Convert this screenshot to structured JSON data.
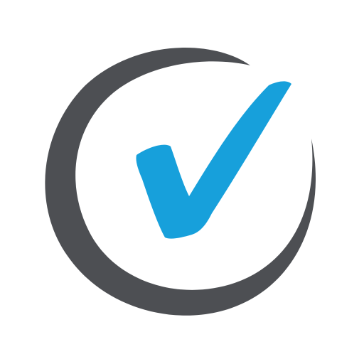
{
  "logo": {
    "icon": "checkmark-circle-icon",
    "colors": {
      "ring": "#4d4f53",
      "check": "#17a0db",
      "background": "#ffffff"
    }
  }
}
